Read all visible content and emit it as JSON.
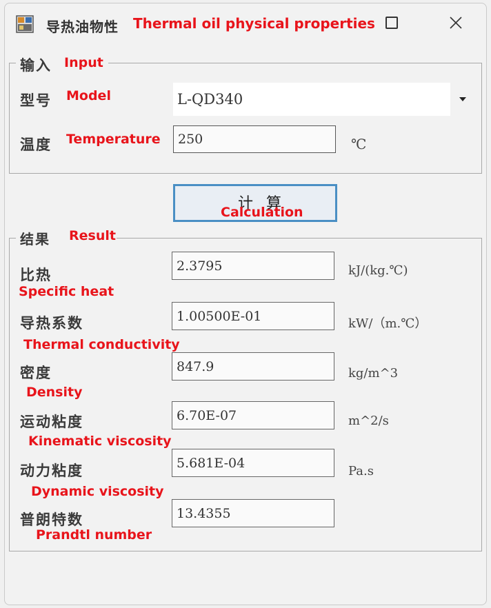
{
  "window": {
    "title_cn": "导热油物性",
    "title_en": "Thermal oil physical properties"
  },
  "input_group": {
    "legend_cn": "输入",
    "legend_en": "Input",
    "model": {
      "label_cn": "型号",
      "label_en": "Model",
      "value": "L-QD340"
    },
    "temperature": {
      "label_cn": "温度",
      "label_en": "Temperature",
      "value": "250",
      "unit": "℃"
    }
  },
  "calc_button": {
    "label_cn": "计 算",
    "label_en": "Calculation"
  },
  "result_group": {
    "legend_cn": "结果",
    "legend_en": "Result",
    "rows": [
      {
        "label_cn": "比热",
        "label_en": "Specific heat",
        "value": "2.3795",
        "unit": "kJ/(kg.℃)"
      },
      {
        "label_cn": "导热系数",
        "label_en": "Thermal conductivity",
        "value": "1.00500E-01",
        "unit": "kW/（m.℃）"
      },
      {
        "label_cn": "密度",
        "label_en": "Density",
        "value": "847.9",
        "unit": "kg/m^3"
      },
      {
        "label_cn": "运动粘度",
        "label_en": "Kinematic viscosity",
        "value": "6.70E-07",
        "unit": "m^2/s"
      },
      {
        "label_cn": "动力粘度",
        "label_en": "Dynamic viscosity",
        "value": "5.681E-04",
        "unit": "Pa.s"
      },
      {
        "label_cn": "普朗特数",
        "label_en": "Prandtl number",
        "value": "13.4355",
        "unit": ""
      }
    ]
  },
  "colors": {
    "annotation": "#e8141b",
    "button_border": "#4a8fc4"
  }
}
